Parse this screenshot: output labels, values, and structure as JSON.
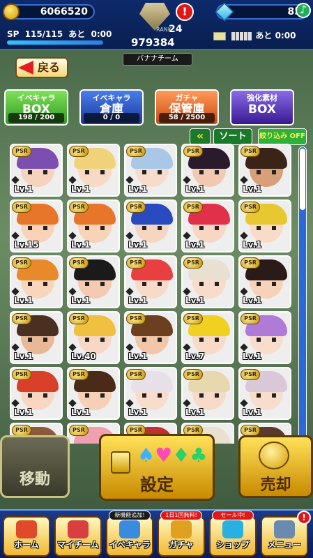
{
  "header": {
    "coins": "6066520",
    "gems": "85",
    "gem_add": "♪",
    "sp_label": "SP",
    "sp_value": "115/115",
    "sp_timer_label": "あと",
    "sp_timer": "0:00",
    "sp_fill": 1.0,
    "rank_label": "RANK",
    "rank": "24",
    "rank_score": "979384",
    "alert": "!",
    "ticket_timer_label": "あと",
    "ticket_timer": "0:00",
    "ticket_segments": 5,
    "team_name": "バナナチーム"
  },
  "back_button": {
    "label": "戻る"
  },
  "tabs": [
    {
      "line1": "イベキャラ",
      "line2": "BOX",
      "count": "198 / 200"
    },
    {
      "line1": "イベキャラ",
      "line2": "倉庫",
      "count": "0 / 0"
    },
    {
      "line1": "ガチャ",
      "line2": "保管庫",
      "count": "58 / 2500"
    },
    {
      "line1": "強化素材",
      "line2": "BOX",
      "count": ""
    }
  ],
  "sort": {
    "arrow": "«",
    "sort_label": "ソート",
    "filter_label": "絞り込み",
    "filter_state": "OFF"
  },
  "cards": [
    {
      "rarity": "PSR",
      "level": "Lv.1",
      "hair": "#7a4fb0",
      "skin": "#f6d3bd"
    },
    {
      "rarity": "PSR",
      "level": "Lv.1",
      "hair": "#f0d27a",
      "skin": "#f8d9c4"
    },
    {
      "rarity": "PSR",
      "level": "Lv.1",
      "hair": "#a9c8e8",
      "skin": "#f8dccb"
    },
    {
      "rarity": "PSR",
      "level": "Lv.1",
      "hair": "#2a1a2a",
      "skin": "#f2c9b0"
    },
    {
      "rarity": "PSR",
      "level": "Lv.1",
      "hair": "#3a2418",
      "skin": "#d7a07a"
    },
    {
      "rarity": "PSR",
      "level": "Lv.15",
      "hair": "#e8762a",
      "skin": "#f8d3b7"
    },
    {
      "rarity": "PSR",
      "level": "Lv.1",
      "hair": "#e8762a",
      "skin": "#f8d3b7"
    },
    {
      "rarity": "PSR",
      "level": "Lv.1",
      "hair": "#2a4ac0",
      "skin": "#f6d6c0"
    },
    {
      "rarity": "PSR",
      "level": "Lv.1",
      "hair": "#e0304a",
      "skin": "#f8d6c4"
    },
    {
      "rarity": "PSR",
      "level": "Lv.1",
      "hair": "#e8c830",
      "skin": "#f8dcc8"
    },
    {
      "rarity": "PSR",
      "level": "Lv.1",
      "hair": "#e88a2a",
      "skin": "#f8d6bd"
    },
    {
      "rarity": "PSR",
      "level": "Lv.1",
      "hair": "#1a1a1a",
      "skin": "#f4cbb0"
    },
    {
      "rarity": "PSR",
      "level": "Lv.1",
      "hair": "#e84040",
      "skin": "#f8dac8"
    },
    {
      "rarity": "PSR",
      "level": "Lv.1",
      "hair": "#e8e0d0",
      "skin": "#f8dcca"
    },
    {
      "rarity": "PSR",
      "level": "Lv.1",
      "hair": "#2a1a18",
      "skin": "#f6d2ba"
    },
    {
      "rarity": "PSR",
      "level": "Lv.1",
      "hair": "#4a3020",
      "skin": "#e8b898"
    },
    {
      "rarity": "PSR",
      "level": "Lv.40",
      "hair": "#f0c040",
      "skin": "#f8d8c4"
    },
    {
      "rarity": "PSR",
      "level": "Lv.1",
      "hair": "#6a4020",
      "skin": "#f2c6a8"
    },
    {
      "rarity": "PSR",
      "level": "Lv.7",
      "hair": "#f0d020",
      "skin": "#f8dac6"
    },
    {
      "rarity": "PSR",
      "level": "Lv.1",
      "hair": "#b07ad8",
      "skin": "#f8dccc"
    },
    {
      "rarity": "PSR",
      "level": "Lv.1",
      "hair": "#d8402a",
      "skin": "#f8d6c2"
    },
    {
      "rarity": "PSR",
      "level": "Lv.1",
      "hair": "#4a2a18",
      "skin": "#f6d0b6"
    },
    {
      "rarity": "PSR",
      "level": "Lv.1",
      "hair": "#e8e0e8",
      "skin": "#f8dccc"
    },
    {
      "rarity": "PSR",
      "level": "Lv.1",
      "hair": "#e8d8b0",
      "skin": "#f8dac8"
    },
    {
      "rarity": "PSR",
      "level": "Lv.1",
      "hair": "#d8c8d8",
      "skin": "#f8dccc"
    },
    {
      "rarity": "PSR",
      "level": "",
      "hair": "#8a5a3a",
      "skin": "#f4cfb6"
    },
    {
      "rarity": "PSR",
      "level": "",
      "hair": "#f0a0b0",
      "skin": "#f8d8cc"
    },
    {
      "rarity": "PSR",
      "level": "",
      "hair": "#c03030",
      "skin": "#f8d6c4"
    },
    {
      "rarity": "PSR",
      "level": "",
      "hair": "#e8e0d0",
      "skin": "#f8dac8"
    },
    {
      "rarity": "PSR",
      "level": "",
      "hair": "#5a3a2a",
      "skin": "#f4ceb4"
    }
  ],
  "scroll_position": 0.0,
  "actions": {
    "move": "移動",
    "settings": "設定",
    "sell": "売却"
  },
  "nav": [
    {
      "label": "ホーム",
      "tag": "",
      "badge": ""
    },
    {
      "label": "マイチーム",
      "tag": "",
      "badge": ""
    },
    {
      "label": "イベキャラ",
      "tag": "新機能追加!",
      "badge": ""
    },
    {
      "label": "ガチャ",
      "tag": "1日1回無料!",
      "badge": ""
    },
    {
      "label": "ショップ",
      "tag": "セール中!",
      "badge": ""
    },
    {
      "label": "メニュー",
      "tag": "",
      "badge": "!"
    }
  ],
  "colors": {
    "accent_blue": "#0d2a6b",
    "gold": "#f2b830",
    "alert_red": "#e01818"
  }
}
